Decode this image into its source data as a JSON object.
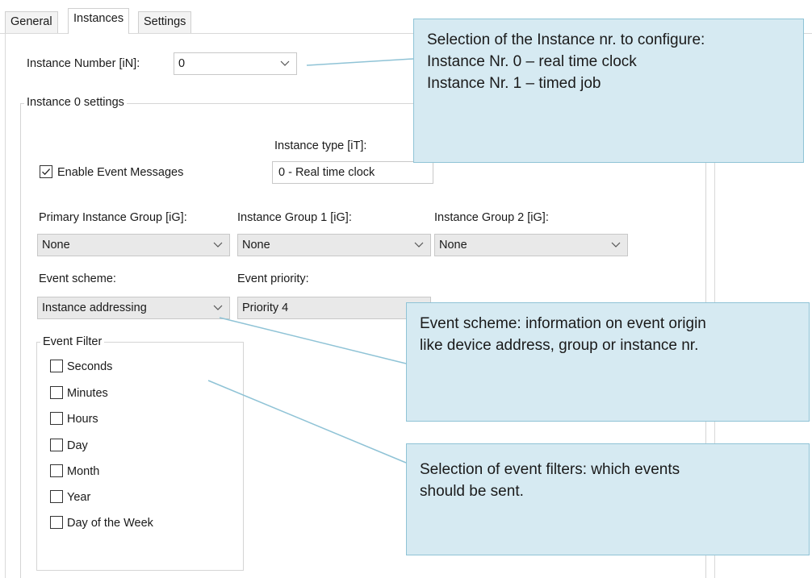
{
  "tabs": [
    {
      "label": "General",
      "active": false
    },
    {
      "label": "Instances",
      "active": true
    },
    {
      "label": "Settings",
      "active": false
    }
  ],
  "instance_number": {
    "label": "Instance Number [iN]:",
    "value": "0"
  },
  "settings_group": {
    "title": "Instance 0 settings"
  },
  "instance_type": {
    "label": "Instance type [iT]:",
    "value": "0 - Real time clock"
  },
  "enable_events": {
    "label": "Enable Event Messages",
    "checked": true
  },
  "groups": {
    "primary": {
      "label": "Primary Instance Group [iG]:",
      "value": "None"
    },
    "group1": {
      "label": "Instance Group 1 [iG]:",
      "value": "None"
    },
    "group2": {
      "label": "Instance Group 2 [iG]:",
      "value": "None"
    }
  },
  "event_scheme": {
    "label": "Event scheme:",
    "value": "Instance addressing"
  },
  "event_priority": {
    "label": "Event priority:",
    "value": "Priority 4"
  },
  "event_filter": {
    "title": "Event Filter",
    "items": [
      {
        "label": "Seconds",
        "checked": false
      },
      {
        "label": "Minutes",
        "checked": false
      },
      {
        "label": "Hours",
        "checked": false
      },
      {
        "label": "Day",
        "checked": false
      },
      {
        "label": "Month",
        "checked": false
      },
      {
        "label": "Year",
        "checked": false
      },
      {
        "label": "Day of the Week",
        "checked": false
      }
    ]
  },
  "callouts": {
    "instance": [
      "Selection of the Instance nr. to configure:",
      "Instance Nr. 0 – real time clock",
      "Instance Nr. 1 – timed job"
    ],
    "scheme": [
      "Event scheme: information on event origin",
      "like device address, group or instance nr."
    ],
    "filters": [
      "Selection of event filters: which events",
      "should be sent."
    ]
  },
  "colors": {
    "callout_fill": "#d6eaf2",
    "callout_border": "#8fc3d6",
    "leader_line": "#8fc3d6"
  },
  "icons": {
    "combo_arrow": "chevron-down-icon",
    "check": "checkmark-icon"
  }
}
